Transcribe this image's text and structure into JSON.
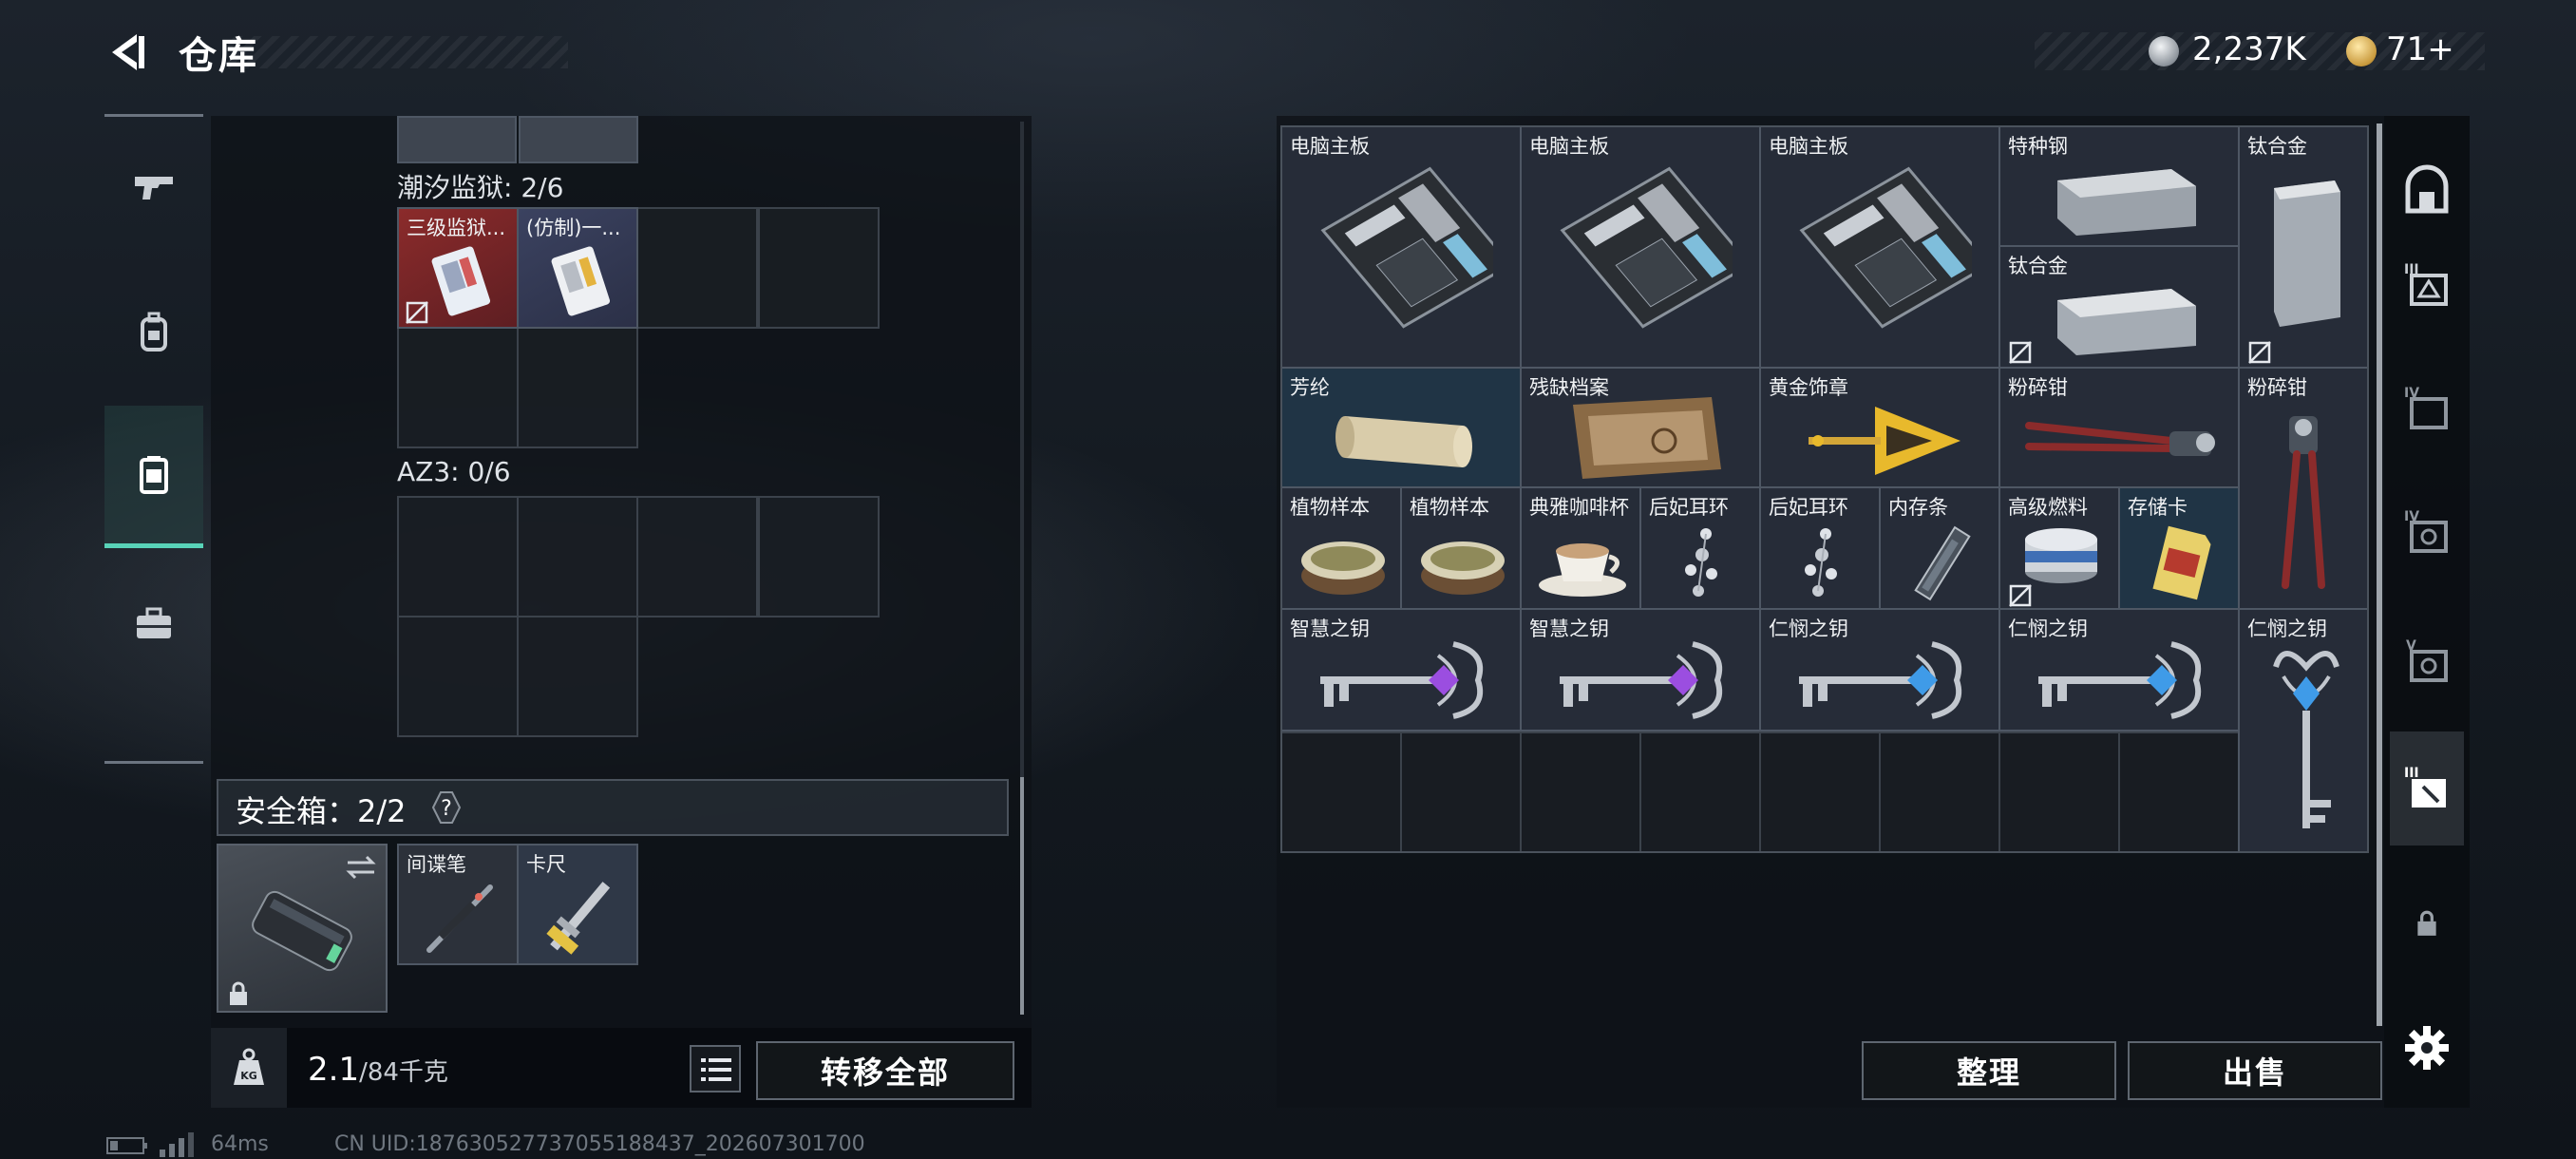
{
  "header": {
    "title": "仓库",
    "currency_silver": "2,237K",
    "currency_gold": "71+"
  },
  "left": {
    "tide_prison_label": "潮汐监狱: 2/6",
    "tide_items": [
      {
        "name": "三级监狱...",
        "accent": "#8b2b2b"
      },
      {
        "name": "(仿制)一..."
      }
    ],
    "az3_label": "AZ3: 0/6",
    "safe_label": "安全箱：2/2",
    "safe_help": "?",
    "safe_items": [
      {
        "name": "间谍笔"
      },
      {
        "name": "卡尺"
      }
    ],
    "weight_current": "2.1",
    "weight_max": "/84千克",
    "transfer_all": "转移全部"
  },
  "right": {
    "items": [
      {
        "name": "电脑主板",
        "icon": "motherboard"
      },
      {
        "name": "电脑主板",
        "icon": "motherboard"
      },
      {
        "name": "电脑主板",
        "icon": "motherboard"
      },
      {
        "name": "特种钢",
        "icon": "steel-ingot"
      },
      {
        "name": "钛合金",
        "icon": "titanium-ingot"
      },
      {
        "name": "钛合金",
        "icon": "titanium-ingot"
      },
      {
        "name": "芳纶",
        "icon": "fabric-roll"
      },
      {
        "name": "残缺档案",
        "icon": "old-document"
      },
      {
        "name": "黄金饰章",
        "icon": "gold-emblem"
      },
      {
        "name": "粉碎钳",
        "icon": "bolt-cutter"
      },
      {
        "name": "粉碎钳",
        "icon": "bolt-cutter"
      },
      {
        "name": "植物样本",
        "icon": "petri-dish"
      },
      {
        "name": "植物样本",
        "icon": "petri-dish"
      },
      {
        "name": "典雅咖啡杯",
        "icon": "coffee-cup"
      },
      {
        "name": "后妃耳环",
        "icon": "earring"
      },
      {
        "name": "后妃耳环",
        "icon": "earring"
      },
      {
        "name": "内存条",
        "icon": "ram-stick"
      },
      {
        "name": "高级燃料",
        "icon": "fuel-can"
      },
      {
        "name": "存储卡",
        "icon": "memory-card"
      },
      {
        "name": "智慧之钥",
        "icon": "ornate-key-purple"
      },
      {
        "name": "智慧之钥",
        "icon": "ornate-key-purple"
      },
      {
        "name": "仁悯之钥",
        "icon": "ornate-key-blue"
      },
      {
        "name": "仁悯之钥",
        "icon": "ornate-key-blue"
      },
      {
        "name": "仁悯之钥",
        "icon": "ornate-key-blue"
      }
    ],
    "sort_button": "整理",
    "sell_button": "出售"
  },
  "footer": {
    "ping": "64ms",
    "uid": "CN UID:187630527737055188437_202607301700"
  },
  "colors": {
    "accent": "#58d3b8",
    "panel": "#0e1217",
    "cell_border": "#3b424b"
  }
}
